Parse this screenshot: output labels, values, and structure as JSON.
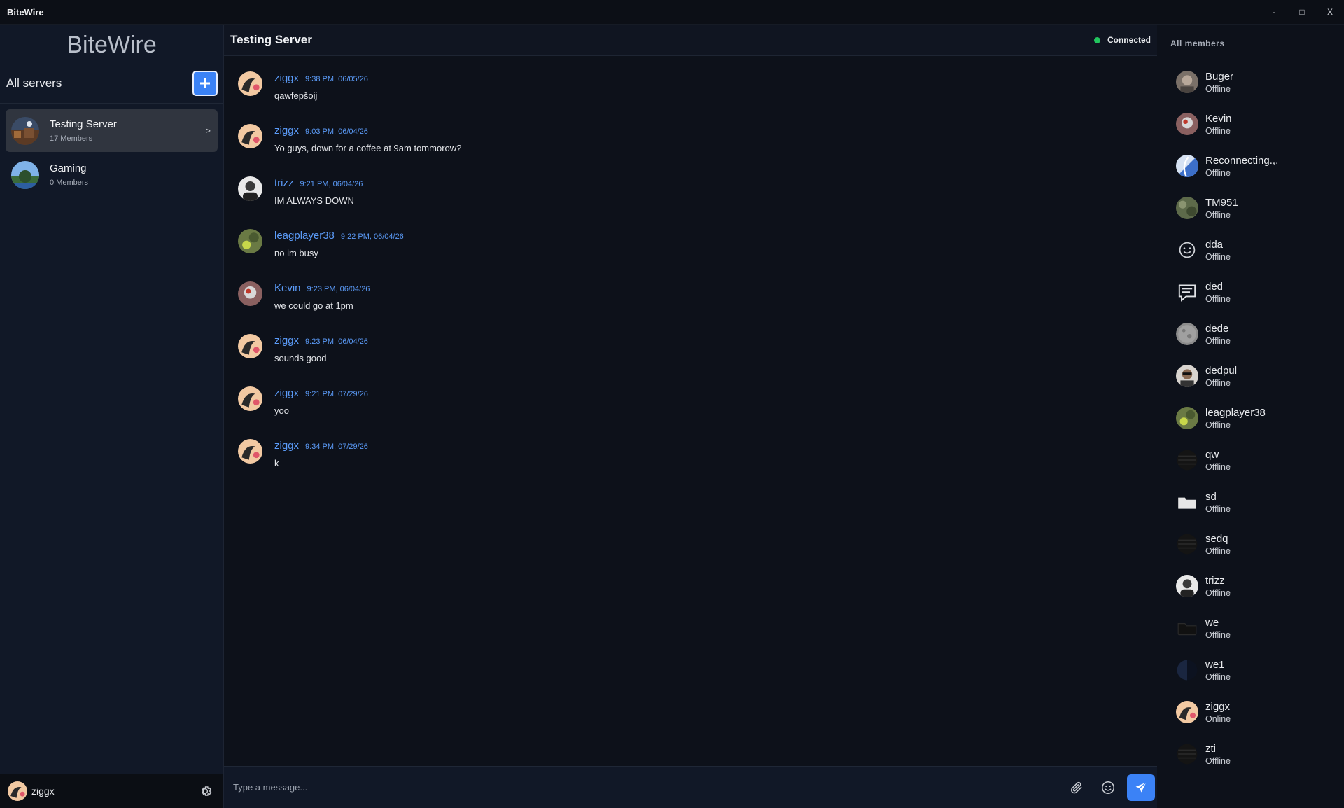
{
  "window": {
    "title": "BiteWire",
    "minimize_label": "-",
    "maximize_label": "□",
    "close_label": "X"
  },
  "sidebar": {
    "brand": "BiteWire",
    "servers_label": "All servers",
    "servers": [
      {
        "name": "Testing Server",
        "members": "17 Members",
        "chevron": ">"
      },
      {
        "name": "Gaming",
        "members": "0 Members"
      }
    ]
  },
  "user": {
    "name": "ziggx"
  },
  "chat": {
    "title": "Testing Server",
    "status": "Connected",
    "status_color": "#22c55e",
    "messages": [
      {
        "author": "ziggx",
        "time": "9:38 PM, 06/05/26",
        "text": "qawfepšoij"
      },
      {
        "author": "ziggx",
        "time": "9:03 PM, 06/04/26",
        "text": "Yo guys, down for a coffee at 9am tommorow?"
      },
      {
        "author": "trizz",
        "time": "9:21 PM, 06/04/26",
        "text": "IM ALWAYS DOWN"
      },
      {
        "author": "leagplayer38",
        "time": "9:22 PM, 06/04/26",
        "text": "no im busy"
      },
      {
        "author": "Kevin",
        "time": "9:23 PM, 06/04/26",
        "text": "we could go at 1pm"
      },
      {
        "author": "ziggx",
        "time": "9:23 PM, 06/04/26",
        "text": "sounds good"
      },
      {
        "author": "ziggx",
        "time": "9:21 PM, 07/29/26",
        "text": "yoo"
      },
      {
        "author": "ziggx",
        "time": "9:34 PM, 07/29/26",
        "text": "k"
      }
    ],
    "input_placeholder": "Type a message..."
  },
  "members": {
    "title": "All members",
    "list": [
      {
        "name": "Buger",
        "status": "Offline"
      },
      {
        "name": "Kevin",
        "status": "Offline"
      },
      {
        "name": "Reconnecting.,.",
        "status": "Offline"
      },
      {
        "name": "TM951",
        "status": "Offline"
      },
      {
        "name": "dda",
        "status": "Offline"
      },
      {
        "name": "ded",
        "status": "Offline"
      },
      {
        "name": "dede",
        "status": "Offline"
      },
      {
        "name": "dedpul",
        "status": "Offline"
      },
      {
        "name": "leagplayer38",
        "status": "Offline"
      },
      {
        "name": "qw",
        "status": "Offline"
      },
      {
        "name": "sd",
        "status": "Offline"
      },
      {
        "name": "sedq",
        "status": "Offline"
      },
      {
        "name": "trizz",
        "status": "Offline"
      },
      {
        "name": "we",
        "status": "Offline"
      },
      {
        "name": "we1",
        "status": "Offline"
      },
      {
        "name": "ziggx",
        "status": "Online"
      },
      {
        "name": "zti",
        "status": "Offline"
      }
    ]
  },
  "colors": {
    "accent": "#3b82f6",
    "link": "#5b9bf8",
    "background": "#0d111a",
    "sidebar": "#111827"
  }
}
